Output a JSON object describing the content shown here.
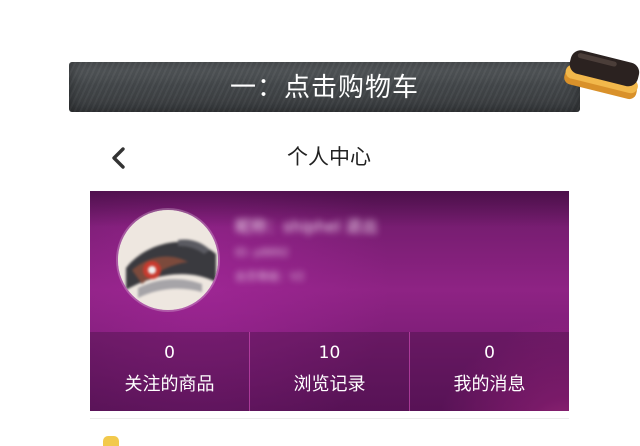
{
  "banner": {
    "title": "一：点击购物车",
    "eraser_icon": "eraser-icon"
  },
  "header": {
    "back_icon": "chevron-left-icon",
    "title": "个人中心"
  },
  "profile": {
    "nickname": "昵称：shiphel 退出",
    "id_line": "ID: p8892",
    "level_line": "会员等级：V2",
    "colors": {
      "accent": "#8e2384",
      "highlight": "#ec46aa",
      "divider": "#e65ac8"
    }
  },
  "stats": [
    {
      "value": "0",
      "label": "关注的商品"
    },
    {
      "value": "10",
      "label": "浏览记录"
    },
    {
      "value": "0",
      "label": "我的消息"
    }
  ]
}
